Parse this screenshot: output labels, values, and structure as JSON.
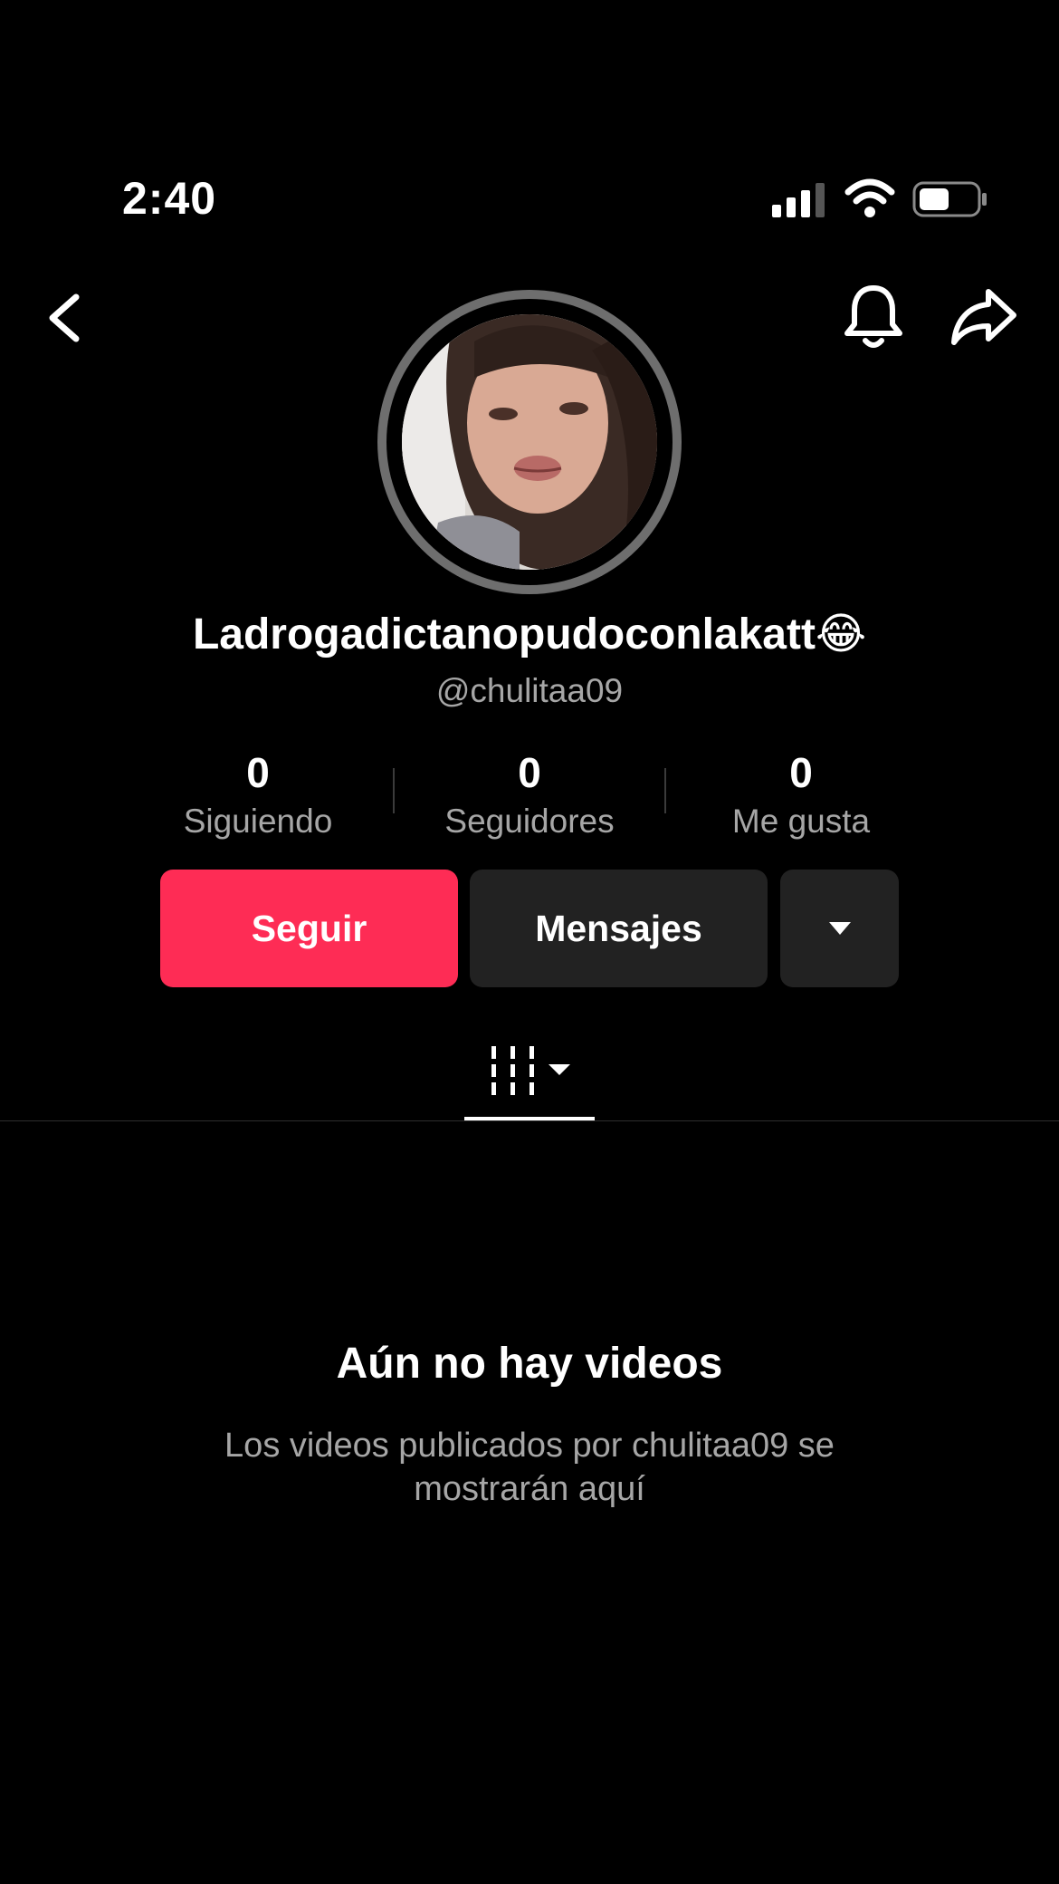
{
  "status_bar": {
    "time": "2:40"
  },
  "profile": {
    "display_name": "Ladrogadictanopudoconlakatt😂",
    "username": "@chulitaa09"
  },
  "stats": [
    {
      "value": "0",
      "label": "Siguiendo"
    },
    {
      "value": "0",
      "label": "Seguidores"
    },
    {
      "value": "0",
      "label": "Me gusta"
    }
  ],
  "actions": {
    "follow_label": "Seguir",
    "message_label": "Mensajes"
  },
  "empty_state": {
    "title": "Aún no hay videos",
    "description": "Los videos publicados por chulitaa09 se mostrarán aquí"
  },
  "colors": {
    "accent": "#fe2c55",
    "background": "#000000",
    "secondary_button": "#222222",
    "muted_text": "#a6a6a6"
  },
  "icons": [
    "back-icon",
    "bell-icon",
    "share-icon",
    "videos-grid-icon",
    "caret-down-icon"
  ]
}
